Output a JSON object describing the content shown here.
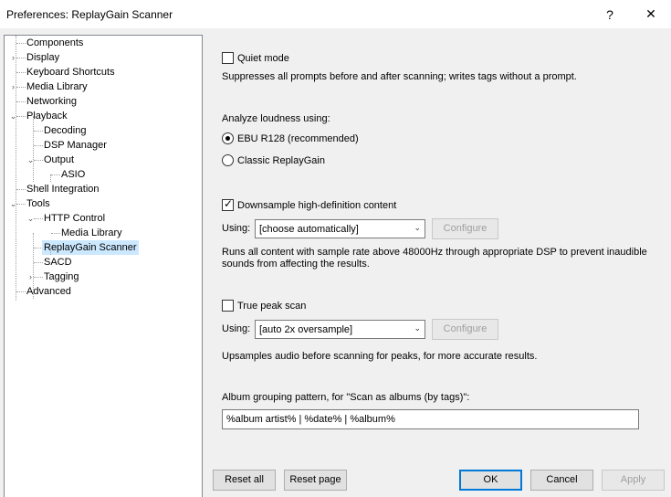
{
  "window": {
    "title": "Preferences: ReplayGain Scanner",
    "help_glyph": "?",
    "close_glyph": "✕"
  },
  "tree": [
    {
      "label": "Components",
      "depth": 0,
      "expander": ""
    },
    {
      "label": "Display",
      "depth": 0,
      "expander": "›"
    },
    {
      "label": "Keyboard Shortcuts",
      "depth": 0,
      "expander": ""
    },
    {
      "label": "Media Library",
      "depth": 0,
      "expander": "›"
    },
    {
      "label": "Networking",
      "depth": 0,
      "expander": ""
    },
    {
      "label": "Playback",
      "depth": 0,
      "expander": "⌄"
    },
    {
      "label": "Decoding",
      "depth": 1,
      "expander": ""
    },
    {
      "label": "DSP Manager",
      "depth": 1,
      "expander": ""
    },
    {
      "label": "Output",
      "depth": 1,
      "expander": "⌄"
    },
    {
      "label": "ASIO",
      "depth": 2,
      "expander": ""
    },
    {
      "label": "Shell Integration",
      "depth": 0,
      "expander": ""
    },
    {
      "label": "Tools",
      "depth": 0,
      "expander": "⌄"
    },
    {
      "label": "HTTP Control",
      "depth": 1,
      "expander": "⌄"
    },
    {
      "label": "Media Library",
      "depth": 2,
      "expander": ""
    },
    {
      "label": "ReplayGain Scanner",
      "depth": 1,
      "expander": "",
      "selected": true
    },
    {
      "label": "SACD",
      "depth": 1,
      "expander": ""
    },
    {
      "label": "Tagging",
      "depth": 1,
      "expander": "›"
    },
    {
      "label": "Advanced",
      "depth": 0,
      "expander": ""
    }
  ],
  "settings": {
    "quiet_mode": {
      "label": "Quiet mode",
      "checked": false,
      "desc": "Suppresses all prompts before and after scanning; writes tags without a prompt."
    },
    "analyze_label": "Analyze loudness using:",
    "ebu": {
      "label": "EBU R128 (recommended)",
      "selected": true
    },
    "classic": {
      "label": "Classic ReplayGain",
      "selected": false
    },
    "downsample": {
      "label": "Downsample high-definition content",
      "checked": true,
      "using_label": "Using:",
      "combo": "[choose automatically]",
      "configure": "Configure",
      "desc": "Runs all content with sample rate above 48000Hz through appropriate DSP to prevent inaudible sounds from affecting the results."
    },
    "truepeak": {
      "label": "True peak scan",
      "checked": false,
      "using_label": "Using:",
      "combo": "[auto 2x oversample]",
      "configure": "Configure",
      "desc": "Upsamples audio before scanning for peaks, for more accurate results."
    },
    "album_label": "Album grouping pattern, for \"Scan as albums (by tags)\":",
    "album_value": "%album artist% | %date% | %album%"
  },
  "buttons": {
    "reset_all": "Reset all",
    "reset_page": "Reset page",
    "ok": "OK",
    "cancel": "Cancel",
    "apply": "Apply"
  },
  "glyphs": {
    "check": "✓",
    "dropdown": "⌄"
  }
}
